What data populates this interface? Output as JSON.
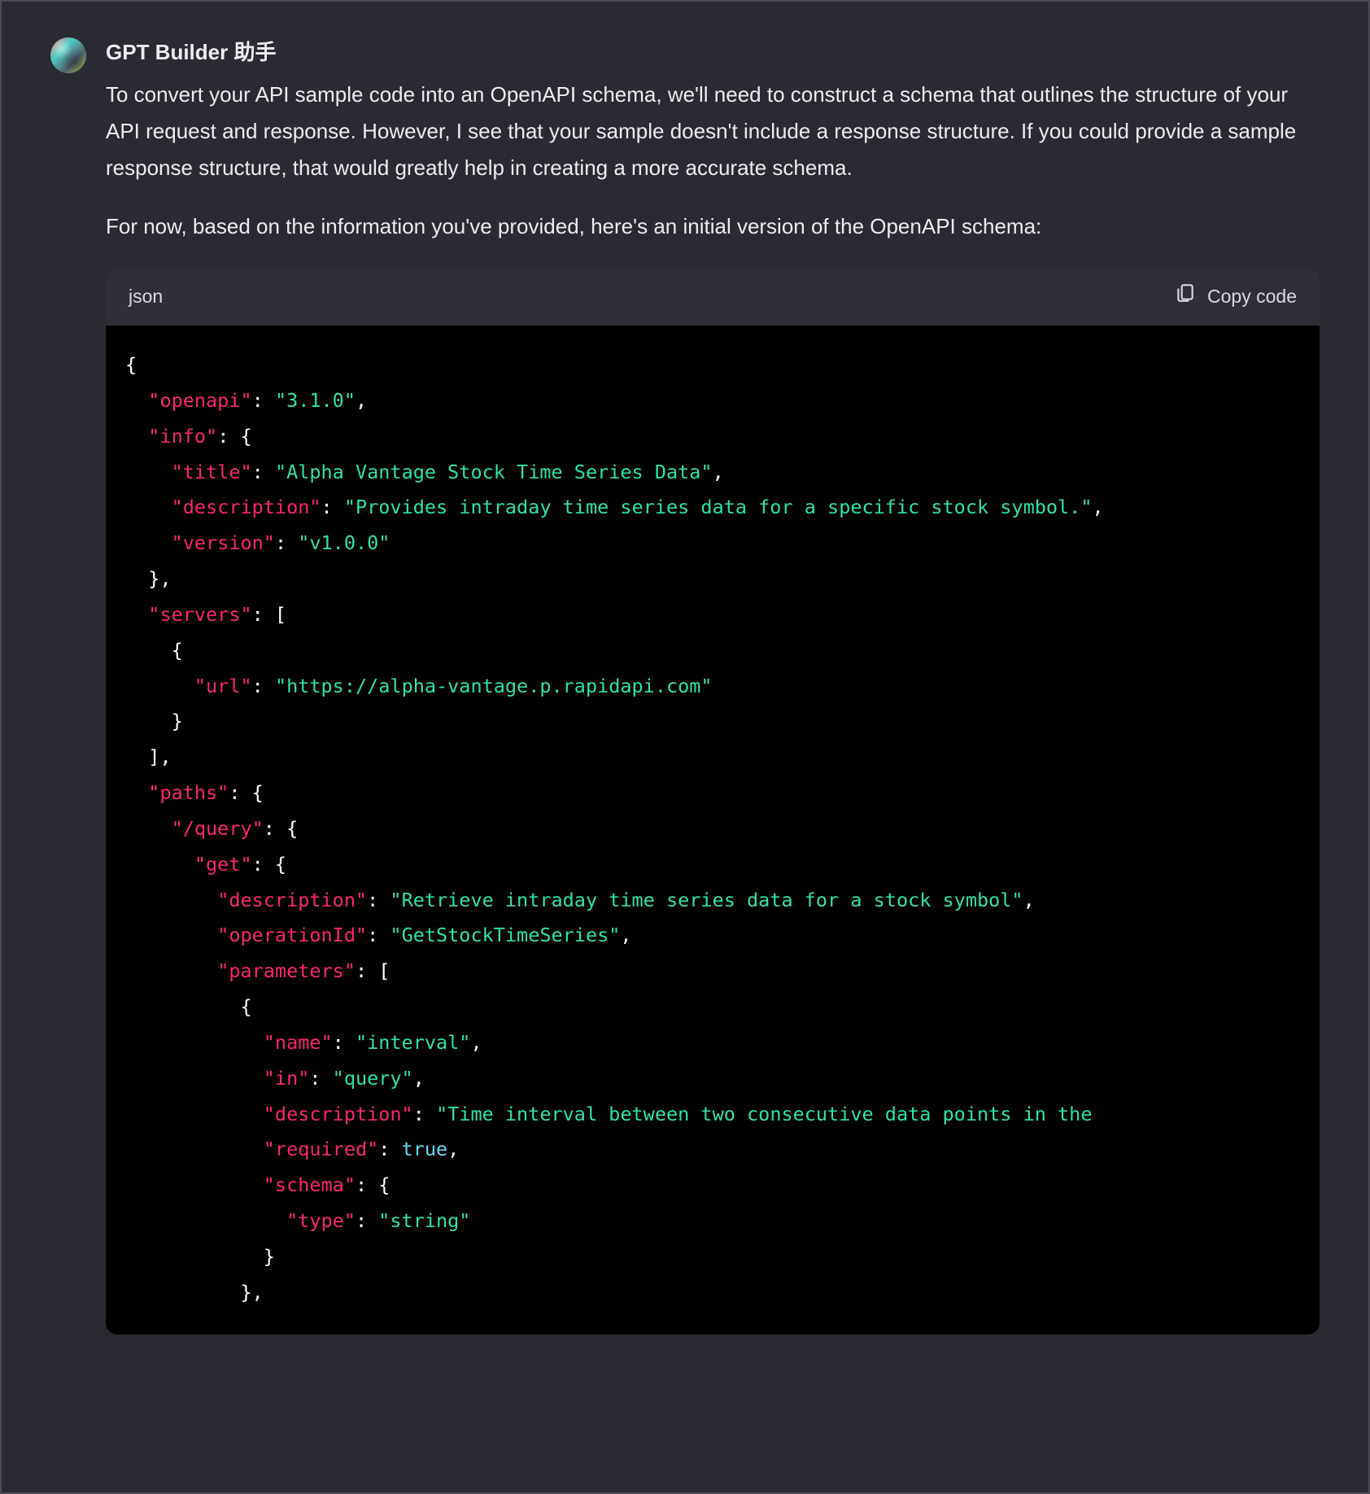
{
  "message": {
    "author": "GPT Builder 助手",
    "paragraph1": "To convert your API sample code into an OpenAPI schema, we'll need to construct a schema that outlines the structure of your API request and response. However, I see that your sample doesn't include a response structure. If you could provide a sample response structure, that would greatly help in creating a more accurate schema.",
    "paragraph2": "For now, based on the information you've provided, here's an initial version of the OpenAPI schema:"
  },
  "codeHeader": {
    "lang": "json",
    "copyLabel": "Copy code"
  },
  "code": {
    "tokens": [
      {
        "t": "punc",
        "v": "{"
      },
      {
        "t": "nl"
      },
      {
        "t": "ind",
        "n": 1
      },
      {
        "t": "key",
        "v": "\"openapi\""
      },
      {
        "t": "punc",
        "v": ": "
      },
      {
        "t": "str",
        "v": "\"3.1.0\""
      },
      {
        "t": "punc",
        "v": ","
      },
      {
        "t": "nl"
      },
      {
        "t": "ind",
        "n": 1
      },
      {
        "t": "key",
        "v": "\"info\""
      },
      {
        "t": "punc",
        "v": ": {"
      },
      {
        "t": "nl"
      },
      {
        "t": "ind",
        "n": 2
      },
      {
        "t": "key",
        "v": "\"title\""
      },
      {
        "t": "punc",
        "v": ": "
      },
      {
        "t": "str",
        "v": "\"Alpha Vantage Stock Time Series Data\""
      },
      {
        "t": "punc",
        "v": ","
      },
      {
        "t": "nl"
      },
      {
        "t": "ind",
        "n": 2
      },
      {
        "t": "key",
        "v": "\"description\""
      },
      {
        "t": "punc",
        "v": ": "
      },
      {
        "t": "str",
        "v": "\"Provides intraday time series data for a specific stock symbol.\""
      },
      {
        "t": "punc",
        "v": ","
      },
      {
        "t": "nl"
      },
      {
        "t": "ind",
        "n": 2
      },
      {
        "t": "key",
        "v": "\"version\""
      },
      {
        "t": "punc",
        "v": ": "
      },
      {
        "t": "str",
        "v": "\"v1.0.0\""
      },
      {
        "t": "nl"
      },
      {
        "t": "ind",
        "n": 1
      },
      {
        "t": "punc",
        "v": "},"
      },
      {
        "t": "nl"
      },
      {
        "t": "ind",
        "n": 1
      },
      {
        "t": "key",
        "v": "\"servers\""
      },
      {
        "t": "punc",
        "v": ": ["
      },
      {
        "t": "nl"
      },
      {
        "t": "ind",
        "n": 2
      },
      {
        "t": "punc",
        "v": "{"
      },
      {
        "t": "nl"
      },
      {
        "t": "ind",
        "n": 3
      },
      {
        "t": "key",
        "v": "\"url\""
      },
      {
        "t": "punc",
        "v": ": "
      },
      {
        "t": "str",
        "v": "\"https://alpha-vantage.p.rapidapi.com\""
      },
      {
        "t": "nl"
      },
      {
        "t": "ind",
        "n": 2
      },
      {
        "t": "punc",
        "v": "}"
      },
      {
        "t": "nl"
      },
      {
        "t": "ind",
        "n": 1
      },
      {
        "t": "punc",
        "v": "],"
      },
      {
        "t": "nl"
      },
      {
        "t": "ind",
        "n": 1
      },
      {
        "t": "key",
        "v": "\"paths\""
      },
      {
        "t": "punc",
        "v": ": {"
      },
      {
        "t": "nl"
      },
      {
        "t": "ind",
        "n": 2
      },
      {
        "t": "key",
        "v": "\"/query\""
      },
      {
        "t": "punc",
        "v": ": {"
      },
      {
        "t": "nl"
      },
      {
        "t": "ind",
        "n": 3
      },
      {
        "t": "key",
        "v": "\"get\""
      },
      {
        "t": "punc",
        "v": ": {"
      },
      {
        "t": "nl"
      },
      {
        "t": "ind",
        "n": 4
      },
      {
        "t": "key",
        "v": "\"description\""
      },
      {
        "t": "punc",
        "v": ": "
      },
      {
        "t": "str",
        "v": "\"Retrieve intraday time series data for a stock symbol\""
      },
      {
        "t": "punc",
        "v": ","
      },
      {
        "t": "nl"
      },
      {
        "t": "ind",
        "n": 4
      },
      {
        "t": "key",
        "v": "\"operationId\""
      },
      {
        "t": "punc",
        "v": ": "
      },
      {
        "t": "str",
        "v": "\"GetStockTimeSeries\""
      },
      {
        "t": "punc",
        "v": ","
      },
      {
        "t": "nl"
      },
      {
        "t": "ind",
        "n": 4
      },
      {
        "t": "key",
        "v": "\"parameters\""
      },
      {
        "t": "punc",
        "v": ": ["
      },
      {
        "t": "nl"
      },
      {
        "t": "ind",
        "n": 5
      },
      {
        "t": "punc",
        "v": "{"
      },
      {
        "t": "nl"
      },
      {
        "t": "ind",
        "n": 6
      },
      {
        "t": "key",
        "v": "\"name\""
      },
      {
        "t": "punc",
        "v": ": "
      },
      {
        "t": "str",
        "v": "\"interval\""
      },
      {
        "t": "punc",
        "v": ","
      },
      {
        "t": "nl"
      },
      {
        "t": "ind",
        "n": 6
      },
      {
        "t": "key",
        "v": "\"in\""
      },
      {
        "t": "punc",
        "v": ": "
      },
      {
        "t": "str",
        "v": "\"query\""
      },
      {
        "t": "punc",
        "v": ","
      },
      {
        "t": "nl"
      },
      {
        "t": "ind",
        "n": 6
      },
      {
        "t": "key",
        "v": "\"description\""
      },
      {
        "t": "punc",
        "v": ": "
      },
      {
        "t": "str",
        "v": "\"Time interval between two consecutive data points in the"
      },
      {
        "t": "nl"
      },
      {
        "t": "ind",
        "n": 6
      },
      {
        "t": "key",
        "v": "\"required\""
      },
      {
        "t": "punc",
        "v": ": "
      },
      {
        "t": "bool",
        "v": "true"
      },
      {
        "t": "punc",
        "v": ","
      },
      {
        "t": "nl"
      },
      {
        "t": "ind",
        "n": 6
      },
      {
        "t": "key",
        "v": "\"schema\""
      },
      {
        "t": "punc",
        "v": ": {"
      },
      {
        "t": "nl"
      },
      {
        "t": "ind",
        "n": 7
      },
      {
        "t": "key",
        "v": "\"type\""
      },
      {
        "t": "punc",
        "v": ": "
      },
      {
        "t": "str",
        "v": "\"string\""
      },
      {
        "t": "nl"
      },
      {
        "t": "ind",
        "n": 6
      },
      {
        "t": "punc",
        "v": "}"
      },
      {
        "t": "nl"
      },
      {
        "t": "ind",
        "n": 5
      },
      {
        "t": "punc",
        "v": "},"
      }
    ]
  }
}
